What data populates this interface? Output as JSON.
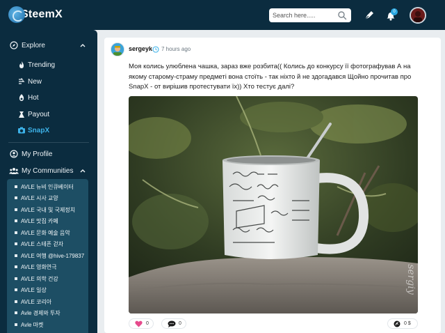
{
  "app": {
    "logo_text": "SteemX"
  },
  "search": {
    "placeholder": "Search here....."
  },
  "header": {
    "notification_count": "0"
  },
  "sidebar": {
    "explore_label": "Explore",
    "items": [
      {
        "label": "Trending",
        "icon": "fire-icon"
      },
      {
        "label": "New",
        "icon": "new-icon"
      },
      {
        "label": "Hot",
        "icon": "hot-icon"
      },
      {
        "label": "Payout",
        "icon": "payout-icon"
      },
      {
        "label": "SnapX",
        "icon": "camera-icon"
      }
    ],
    "profile_label": "My Profile",
    "communities_label": "My Communities",
    "communities": [
      "AVLE 뉴비 인큐베이터",
      "AVLE 시사 교양",
      "AVLE 국내 및 국제정치",
      "AVLE 맛집 카페",
      "AVLE 문화 예술 음악",
      "AVLE 스테픈 걷자",
      "AVLE 여행 @hive-179837",
      "AVLE 영화연극",
      "AVLE 의학 건강",
      "AVLE 일상",
      "AVLE 코리아",
      "Avle 경제와 투자",
      "Avle 마켓"
    ]
  },
  "post": {
    "author": "sergeyk",
    "time": "7 hours ago",
    "body": "Моя колись улюблена чашка, зараз вже розбита(( Колись до конкурсу її фотографував А на якому старому-страму предметі вона стоїть - так ніхто й не здогадався Щойно прочитав про SnapX - от вирішив протестувати їх)) Хто тестує далі?",
    "photo_watermark": "sergiy",
    "likes": "0",
    "comments": "0",
    "payout": "0 $"
  },
  "colors": {
    "topbar": "#0b2c3f",
    "accent": "#3db3ea",
    "community_box": "#1d4e64",
    "like": "#e64a8c"
  }
}
